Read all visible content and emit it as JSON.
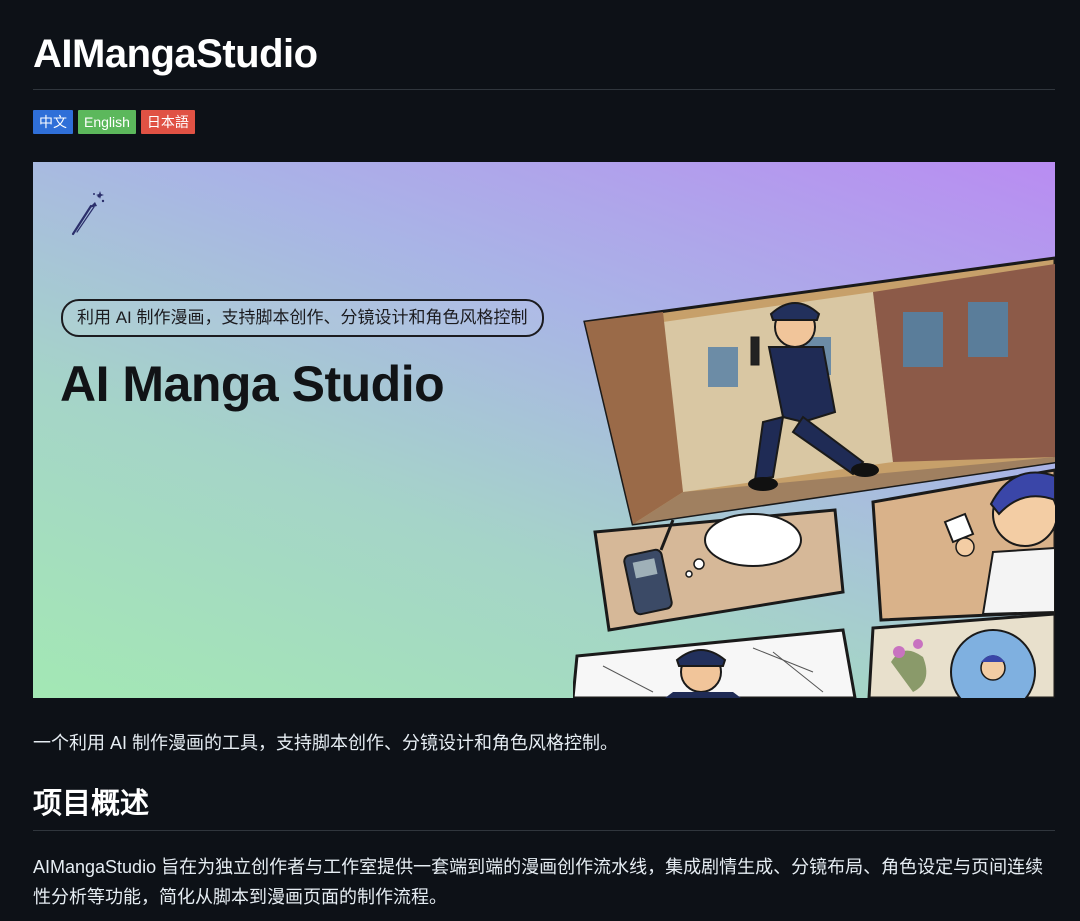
{
  "readme": {
    "title": "AIMangaStudio",
    "badges": [
      {
        "label": "中文",
        "color": "#2f6fd8"
      },
      {
        "label": "English",
        "color": "#5cb85c"
      },
      {
        "label": "日本語",
        "color": "#e05244"
      }
    ],
    "banner": {
      "tagline": "利用 AI 制作漫画，支持脚本创作、分镜设计和角色风格控制",
      "title": "AI Manga Studio",
      "icon": "magic-pen-icon"
    },
    "description": "一个利用 AI 制作漫画的工具，支持脚本创作、分镜设计和角色风格控制。",
    "overview": {
      "heading": "项目概述",
      "body": "AIMangaStudio 旨在为独立创作者与工作室提供一套端到端的漫画创作流水线，集成剧情生成、分镜布局、角色设定与页间连续性分析等功能，简化从脚本到漫画页面的制作流程。"
    }
  }
}
